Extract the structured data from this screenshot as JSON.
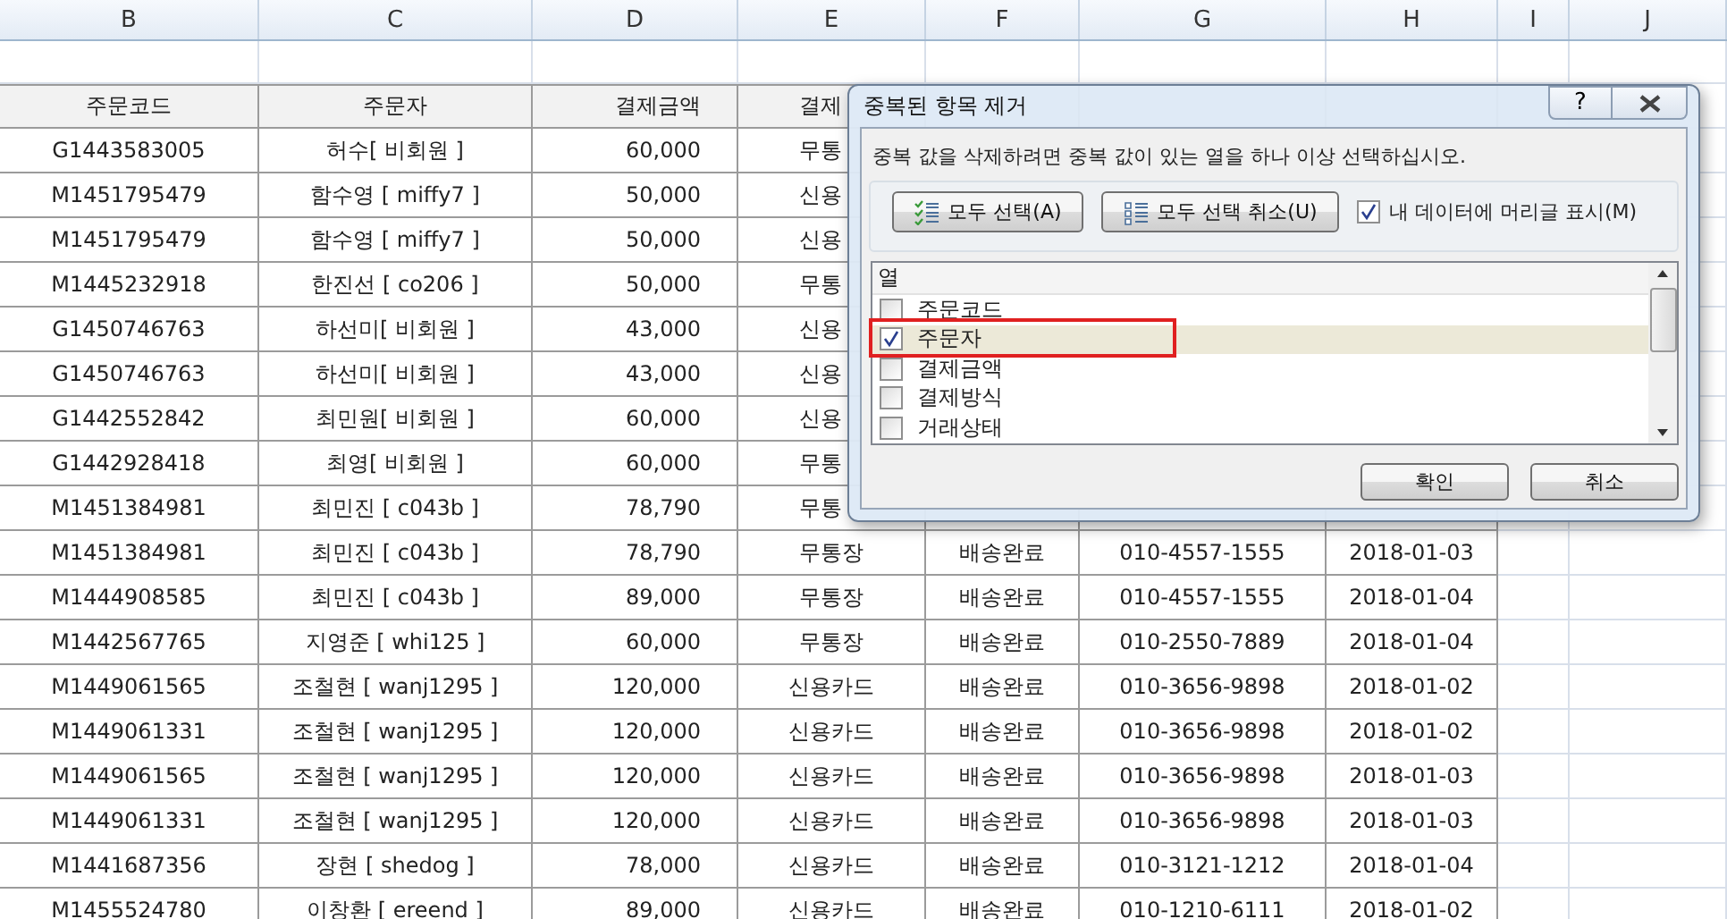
{
  "column_letters": [
    "B",
    "C",
    "D",
    "E",
    "F",
    "G",
    "H",
    "I",
    "J"
  ],
  "table": {
    "headers": [
      "주문코드",
      "주문자",
      "결제금액",
      "결제"
    ],
    "rows": [
      {
        "cells": [
          "G1443583005",
          "허수[ 비회원 ]",
          "60,000",
          "무통"
        ]
      },
      {
        "cells": [
          "M1451795479",
          "함수영 [ miffy7 ]",
          "50,000",
          "신용"
        ]
      },
      {
        "cells": [
          "M1451795479",
          "함수영 [ miffy7 ]",
          "50,000",
          "신용"
        ]
      },
      {
        "cells": [
          "M1445232918",
          "한진선 [ co206 ]",
          "50,000",
          "무통"
        ]
      },
      {
        "cells": [
          "G1450746763",
          "하선미[ 비회원 ]",
          "43,000",
          "신용"
        ]
      },
      {
        "cells": [
          "G1450746763",
          "하선미[ 비회원 ]",
          "43,000",
          "신용"
        ]
      },
      {
        "cells": [
          "G1442552842",
          "최민원[ 비회원 ]",
          "60,000",
          "신용"
        ]
      },
      {
        "cells": [
          "G1442928418",
          "최영[ 비회원 ]",
          "60,000",
          "무통"
        ]
      },
      {
        "cells": [
          "M1451384981",
          "최민진 [ c043b ]",
          "78,790",
          "무통"
        ]
      },
      {
        "cells": [
          "M1451384981",
          "최민진 [ c043b ]",
          "78,790",
          "무통장",
          "배송완료",
          "010-4557-1555",
          "2018-01-03"
        ]
      },
      {
        "cells": [
          "M1444908585",
          "최민진 [ c043b ]",
          "89,000",
          "무통장",
          "배송완료",
          "010-4557-1555",
          "2018-01-04"
        ]
      },
      {
        "cells": [
          "M1442567765",
          "지영준 [ whi125 ]",
          "60,000",
          "무통장",
          "배송완료",
          "010-2550-7889",
          "2018-01-04"
        ]
      },
      {
        "cells": [
          "M1449061565",
          "조철현 [ wanj1295 ]",
          "120,000",
          "신용카드",
          "배송완료",
          "010-3656-9898",
          "2018-01-02"
        ]
      },
      {
        "cells": [
          "M1449061331",
          "조철현 [ wanj1295 ]",
          "120,000",
          "신용카드",
          "배송완료",
          "010-3656-9898",
          "2018-01-02"
        ]
      },
      {
        "cells": [
          "M1449061565",
          "조철현 [ wanj1295 ]",
          "120,000",
          "신용카드",
          "배송완료",
          "010-3656-9898",
          "2018-01-03"
        ]
      },
      {
        "cells": [
          "M1449061331",
          "조철현 [ wanj1295 ]",
          "120,000",
          "신용카드",
          "배송완료",
          "010-3656-9898",
          "2018-01-03"
        ]
      },
      {
        "cells": [
          "M1441687356",
          "장현 [ shedog ]",
          "78,000",
          "신용카드",
          "배송완료",
          "010-3121-1212",
          "2018-01-04"
        ]
      },
      {
        "cells": [
          "M1455524780",
          "이창환 [ ereend ]",
          "89,000",
          "신용카드",
          "배송완료",
          "010-1210-6111",
          "2018-01-02"
        ]
      }
    ]
  },
  "dialog": {
    "title": "중복된 항목 제거",
    "help": "?",
    "instruction": "중복 값을 삭제하려면 중복 값이 있는 열을 하나 이상 선택하십시오.",
    "select_all": "모두 선택(A)",
    "unselect_all": "모두 선택 취소(U)",
    "headers_checkbox": {
      "label": "내 데이터에 머리글 표시(M)",
      "checked": true
    },
    "list_header": "열",
    "columns": [
      {
        "label": "주문코드",
        "checked": false,
        "selected": false,
        "annotated": false
      },
      {
        "label": "주문자",
        "checked": true,
        "selected": true,
        "annotated": true
      },
      {
        "label": "결제금액",
        "checked": false,
        "selected": false,
        "annotated": false
      },
      {
        "label": "결제방식",
        "checked": false,
        "selected": false,
        "annotated": false
      },
      {
        "label": "거래상태",
        "checked": false,
        "selected": false,
        "annotated": false
      }
    ],
    "ok": "확인",
    "cancel": "취소"
  }
}
